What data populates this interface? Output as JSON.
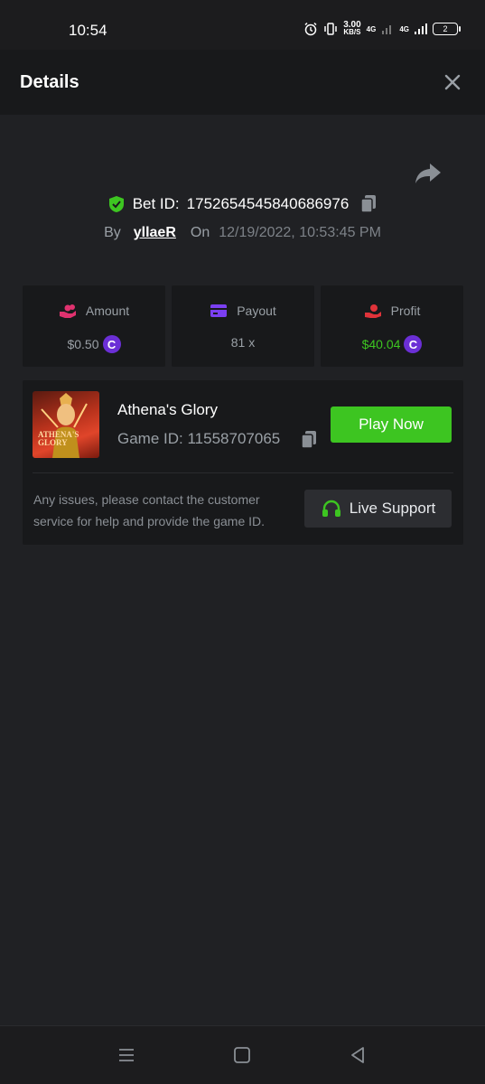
{
  "status_bar": {
    "time": "10:54",
    "speed_value": "3.00",
    "speed_unit": "KB/S",
    "network_1": "4G",
    "network_2": "4G",
    "battery": "2"
  },
  "header": {
    "title": "Details"
  },
  "bet": {
    "id_label": "Bet ID:",
    "id_value": "1752654545840686976",
    "by_label": "By",
    "username": "yllaeR",
    "on_label": "On",
    "datetime": "12/19/2022, 10:53:45 PM"
  },
  "stats": {
    "amount": {
      "label": "Amount",
      "value": "$0.50",
      "icon": "hand-coins-icon",
      "color": "#e0326f"
    },
    "payout": {
      "label": "Payout",
      "value": "81 x",
      "icon": "card-icon",
      "color": "#7b3ff2"
    },
    "profit": {
      "label": "Profit",
      "value": "$40.04",
      "icon": "hand-money-icon",
      "color": "#e0333a"
    },
    "coin_symbol": "C"
  },
  "game": {
    "thumb_text": "ATHENA'S GLORY",
    "name": "Athena's Glory",
    "id_label": "Game ID:",
    "id_value": "11558707065",
    "play_label": "Play Now",
    "notice": "Any issues, please contact the customer service for help and provide the game ID.",
    "support_label": "Live Support"
  },
  "colors": {
    "accent_green": "#3dc521",
    "background": "#202124",
    "panel": "#18191b"
  }
}
